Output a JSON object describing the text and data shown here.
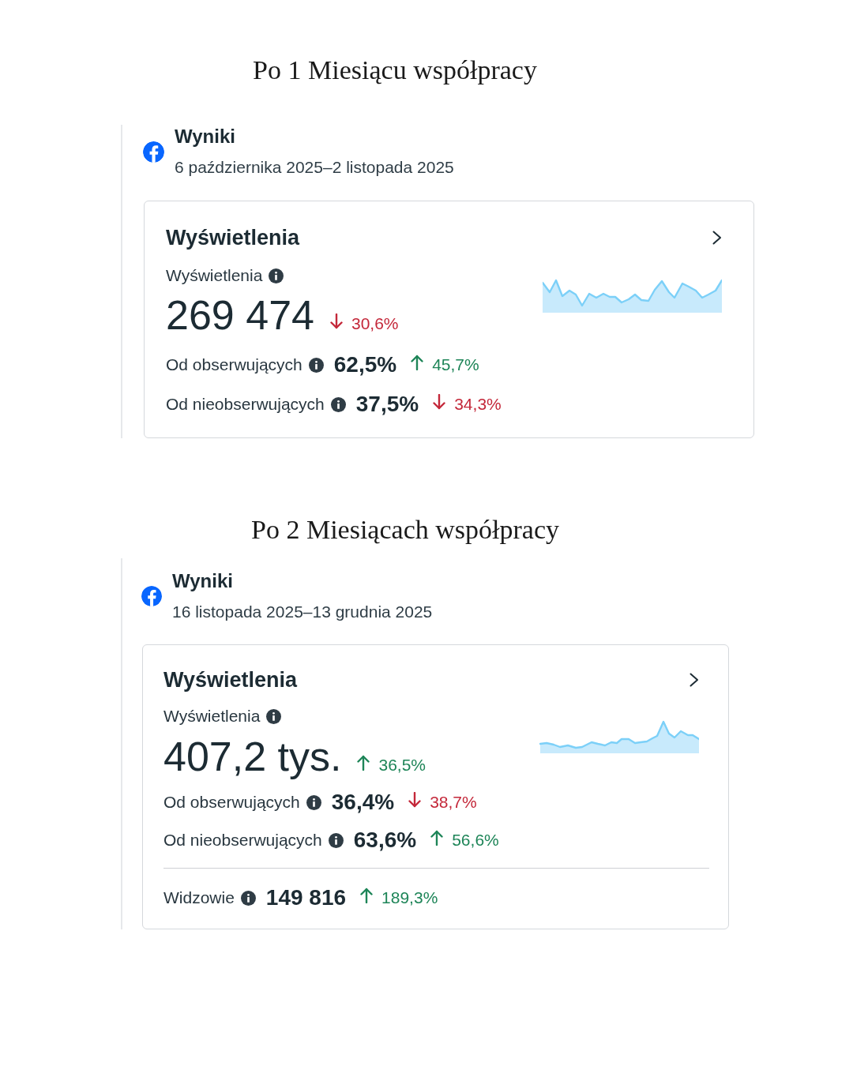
{
  "sections": [
    {
      "heading": "Po 1 Miesiącu współpracy",
      "results": {
        "title": "Wyniki",
        "date_range": "6 października 2025–2 listopada 2025"
      },
      "card": {
        "title": "Wyświetlenia",
        "metric_label": "Wyświetlenia",
        "value": "269 474",
        "change": {
          "increase": false,
          "text": "30,6%"
        },
        "breakdown": [
          {
            "label": "Od obserwujących",
            "value": "62,5%",
            "change": {
              "increase": true,
              "text": "45,7%"
            }
          },
          {
            "label": "Od nieobserwujących",
            "value": "37,5%",
            "change": {
              "increase": false,
              "text": "34,3%"
            }
          }
        ]
      }
    },
    {
      "heading": "Po 2 Miesiącach współpracy",
      "results": {
        "title": "Wyniki",
        "date_range": "16 listopada 2025–13 grudnia 2025"
      },
      "card": {
        "title": "Wyświetlenia",
        "metric_label": "Wyświetlenia",
        "value": "407,2 tys.",
        "change": {
          "increase": true,
          "text": "36,5%"
        },
        "breakdown": [
          {
            "label": "Od obserwujących",
            "value": "36,4%",
            "change": {
              "increase": false,
              "text": "38,7%"
            }
          },
          {
            "label": "Od nieobserwujących",
            "value": "63,6%",
            "change": {
              "increase": true,
              "text": "56,6%"
            }
          }
        ],
        "footer_rows": [
          {
            "label": "Widzowie",
            "value": "149 816",
            "change": {
              "increase": true,
              "text": "189,3%"
            }
          }
        ]
      }
    }
  ]
}
